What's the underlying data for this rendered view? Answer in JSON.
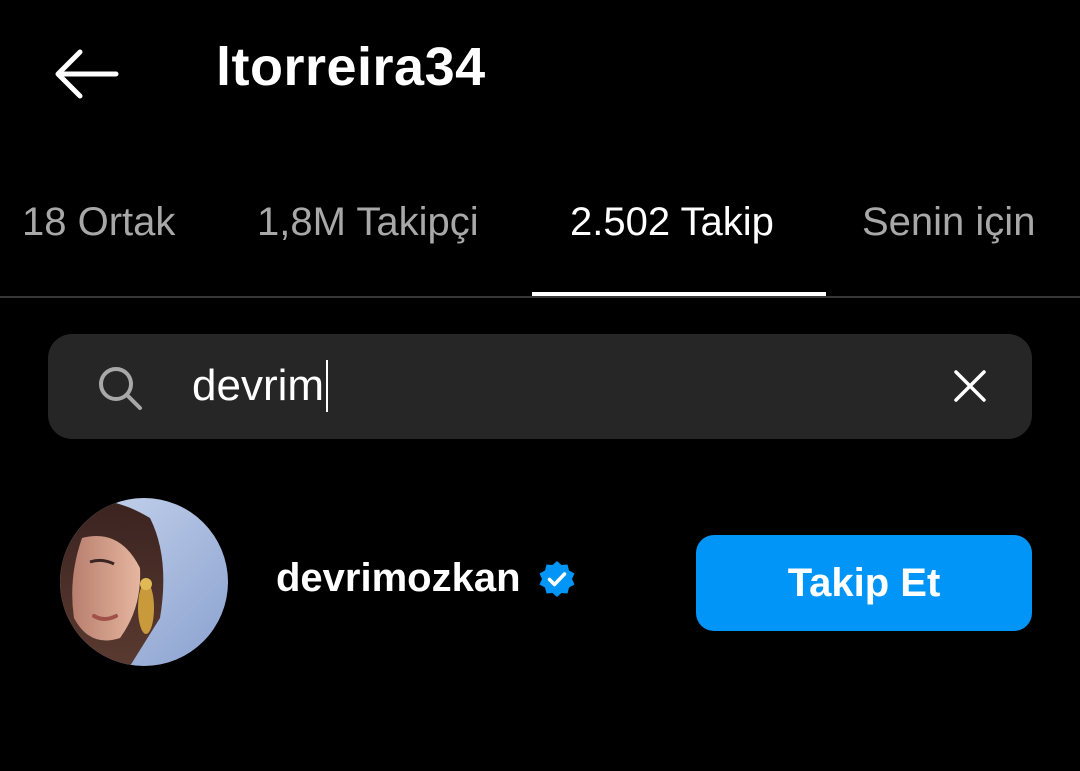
{
  "header": {
    "title": "ltorreira34",
    "back_icon": "arrow-left-icon"
  },
  "tabs": [
    {
      "label": "18 Ortak",
      "active": false
    },
    {
      "label": "1,8M Takipçi",
      "active": false
    },
    {
      "label": "2.502 Takip",
      "active": true
    },
    {
      "label": "Senin için",
      "active": false
    }
  ],
  "search": {
    "value": "devrim",
    "search_icon": "search-icon",
    "clear_icon": "close-icon"
  },
  "results": [
    {
      "username": "devrimozkan",
      "verified": true,
      "follow_label": "Takip Et"
    }
  ],
  "colors": {
    "background": "#000000",
    "accent": "#0095f6",
    "search_bg": "#262626",
    "inactive_tab": "#a8a8a8",
    "divider": "#363636"
  }
}
